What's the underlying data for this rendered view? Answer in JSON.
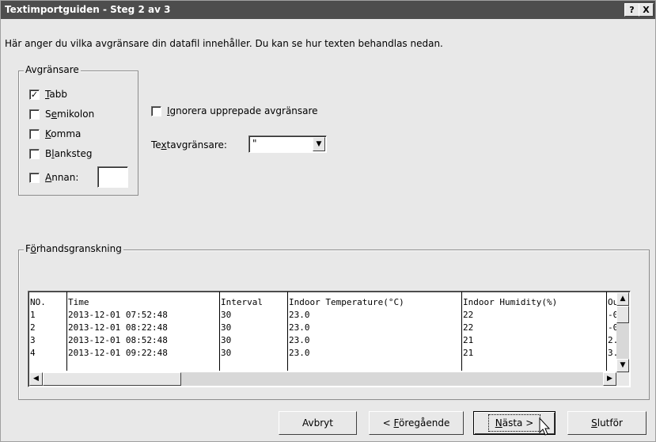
{
  "window": {
    "title": "Textimportguiden - Steg 2 av 3",
    "help_label": "?",
    "close_label": "X"
  },
  "description": "Här anger du vilka avgränsare din datafil innehåller. Du kan se hur texten behandlas nedan.",
  "delimiters": {
    "group_label": "Avgränsare",
    "tab": {
      "mnemonic": "T",
      "rest": "abb",
      "checked": true
    },
    "semicolon": {
      "pre": "S",
      "mnemonic": "e",
      "rest": "mikolon",
      "checked": false
    },
    "comma": {
      "mnemonic": "K",
      "rest": "omma",
      "checked": false
    },
    "space": {
      "pre": "B",
      "mnemonic": "l",
      "rest": "anksteg",
      "checked": false
    },
    "other": {
      "mnemonic": "A",
      "rest": "nnan:",
      "checked": false,
      "value": ""
    }
  },
  "ignore_repeated": {
    "mnemonic": "I",
    "rest": "gnorera upprepade avgränsare",
    "checked": false
  },
  "text_qualifier": {
    "pre": "Te",
    "mnemonic": "x",
    "rest": "tavgränsare:",
    "value": "\""
  },
  "preview": {
    "group_pre": "F",
    "group_mnemonic": "ö",
    "group_rest": "rhandsgranskning",
    "headers": [
      "NO.",
      "Time",
      "Interval",
      "Indoor Temperature(°C)",
      "Indoor Humidity(%)",
      "Ou"
    ],
    "rows": [
      [
        "1",
        "2013-12-01 07:52:48",
        "30",
        "23.0",
        "22",
        "-0"
      ],
      [
        "2",
        "2013-12-01 08:22:48",
        "30",
        "23.0",
        "22",
        "-0"
      ],
      [
        "3",
        "2013-12-01 08:52:48",
        "30",
        "23.0",
        "21",
        "2."
      ],
      [
        "4",
        "2013-12-01 09:22:48",
        "30",
        "23.0",
        "21",
        "3."
      ]
    ]
  },
  "buttons": {
    "cancel": "Avbryt",
    "back_pre": "< ",
    "back_mnemonic": "F",
    "back_rest": "öregående",
    "next_mnemonic": "N",
    "next_rest": "ästa >",
    "finish_mnemonic": "S",
    "finish_rest": "lutför"
  }
}
